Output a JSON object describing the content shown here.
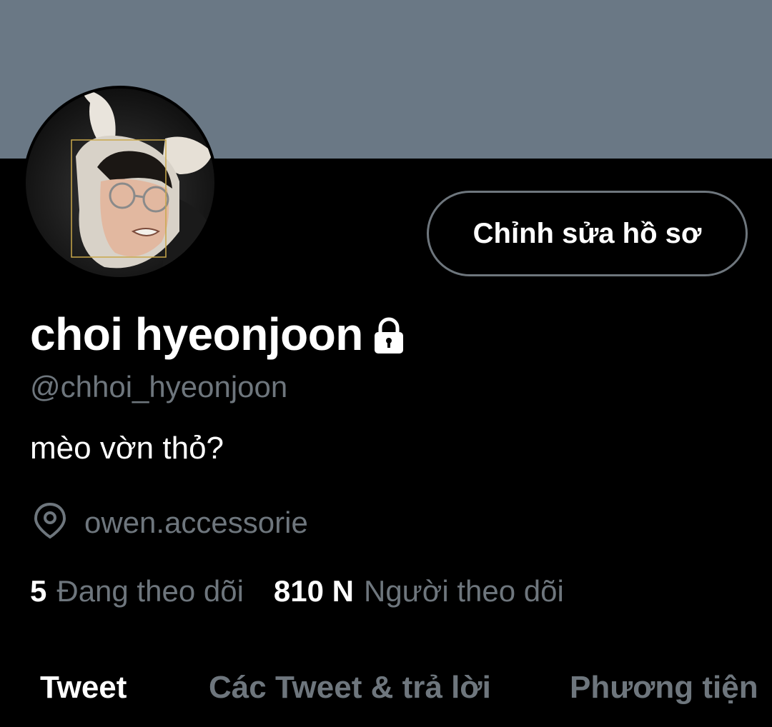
{
  "profile": {
    "edit_button_label": "Chỉnh sửa hồ sơ",
    "display_name": "choi hyeonjoon",
    "handle": "@chhoi_hyeonjoon",
    "bio": "mèo vờn thỏ?",
    "location": "owen.accessorie",
    "protected_icon": "lock-icon",
    "location_icon": "location-pin-icon"
  },
  "stats": {
    "following_count": "5",
    "following_label": "Đang theo dõi",
    "followers_count": "810 N",
    "followers_label": "Người theo dõi"
  },
  "tabs": [
    {
      "label": "Tweet",
      "active": true
    },
    {
      "label": "Các Tweet & trả lời",
      "active": false
    },
    {
      "label": "Phương tiện",
      "active": false
    }
  ],
  "colors": {
    "banner": "#6a7885",
    "background": "#000000",
    "primary_text": "#ffffff",
    "secondary_text": "#6e767d",
    "button_border": "#6e767d"
  }
}
